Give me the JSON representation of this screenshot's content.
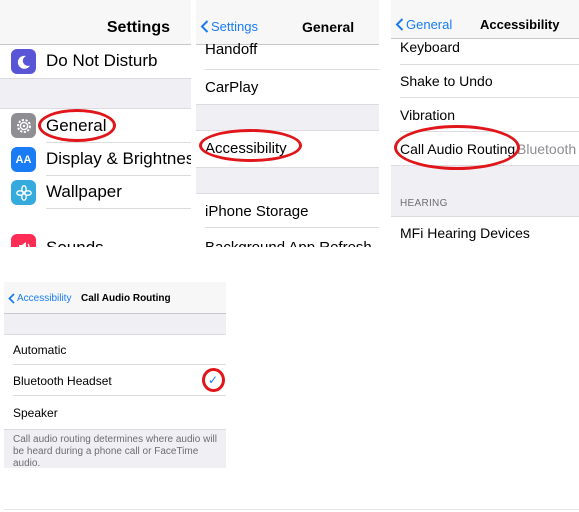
{
  "panels": {
    "settings": {
      "title": "Settings",
      "items": [
        {
          "label": "Do Not Disturb",
          "icon": "moon-icon",
          "icon_color": "#5856d6"
        },
        {
          "label": "General",
          "icon": "gear-icon",
          "icon_color": "#8e8e93"
        },
        {
          "label": "Display & Brightness",
          "icon": "display-brightness-icon",
          "icon_color": "#1a7cf5",
          "icon_text": "AA"
        },
        {
          "label": "Wallpaper",
          "icon": "wallpaper-flower-icon",
          "icon_color": "#35aadc"
        },
        {
          "label": "Sounds",
          "icon": "speaker-icon",
          "icon_color": "#ff2d55"
        }
      ]
    },
    "general": {
      "back": "Settings",
      "title": "General",
      "items": [
        "Handoff",
        "CarPlay",
        "Accessibility",
        "iPhone Storage",
        "Background App Refresh"
      ]
    },
    "accessibility": {
      "back": "General",
      "title": "Accessibility",
      "items": [
        "Keyboard",
        "Shake to Undo",
        "Vibration"
      ],
      "call_audio": {
        "label": "Call Audio Routing",
        "value": "Bluetooth"
      },
      "hearing_header": "HEARING",
      "hearing_items": [
        "MFi Hearing Devices"
      ]
    },
    "call_audio_routing": {
      "back": "Accessibility",
      "title": "Call Audio Routing",
      "options": [
        "Automatic",
        "Bluetooth Headset",
        "Speaker"
      ],
      "selected": "Bluetooth Headset",
      "footer": "Call audio routing determines where audio will be heard during a phone call or FaceTime audio."
    }
  },
  "colors": {
    "accent": "#1a7cf5",
    "highlight_oval": "#e0161b",
    "grouped_background": "#efeff4"
  }
}
